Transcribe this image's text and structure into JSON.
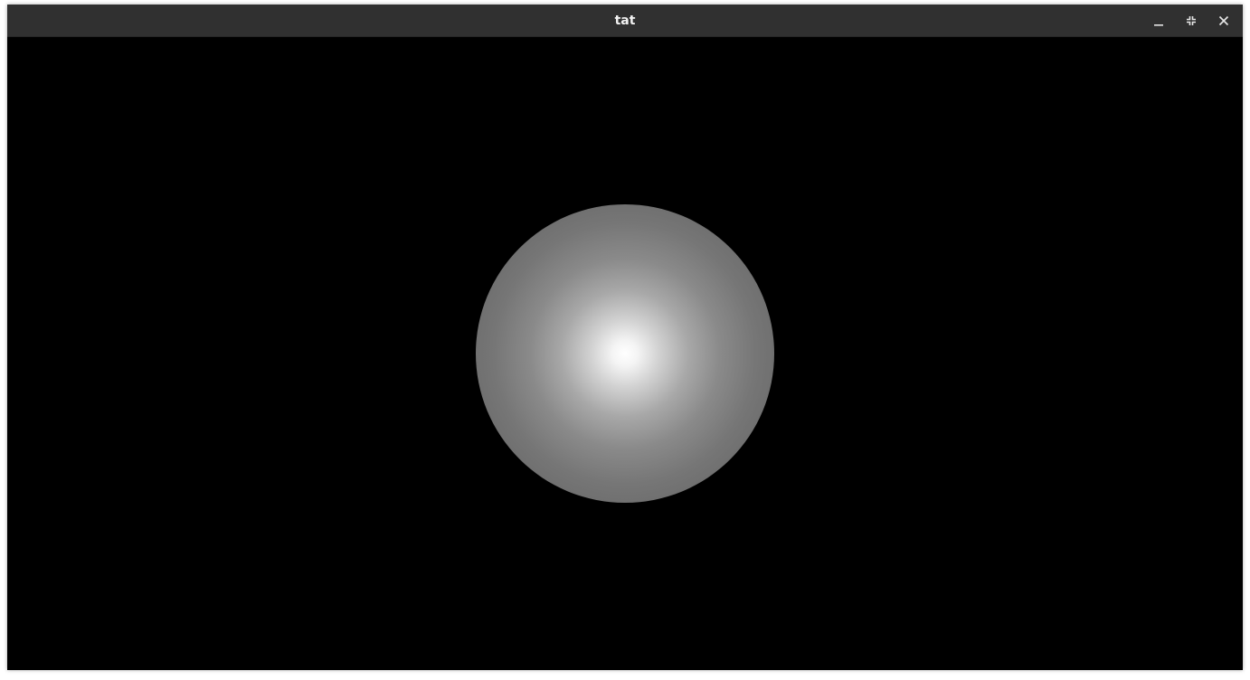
{
  "window": {
    "title": "tat",
    "controls": {
      "minimize_icon": "minimize-icon",
      "restore_icon": "restore-icon",
      "close_icon": "close-icon"
    }
  },
  "scene": {
    "background_color": "#000000",
    "object": "shaded-sphere",
    "highlight_color": "#ffffff",
    "shadow_color": "#5e5e5e"
  }
}
